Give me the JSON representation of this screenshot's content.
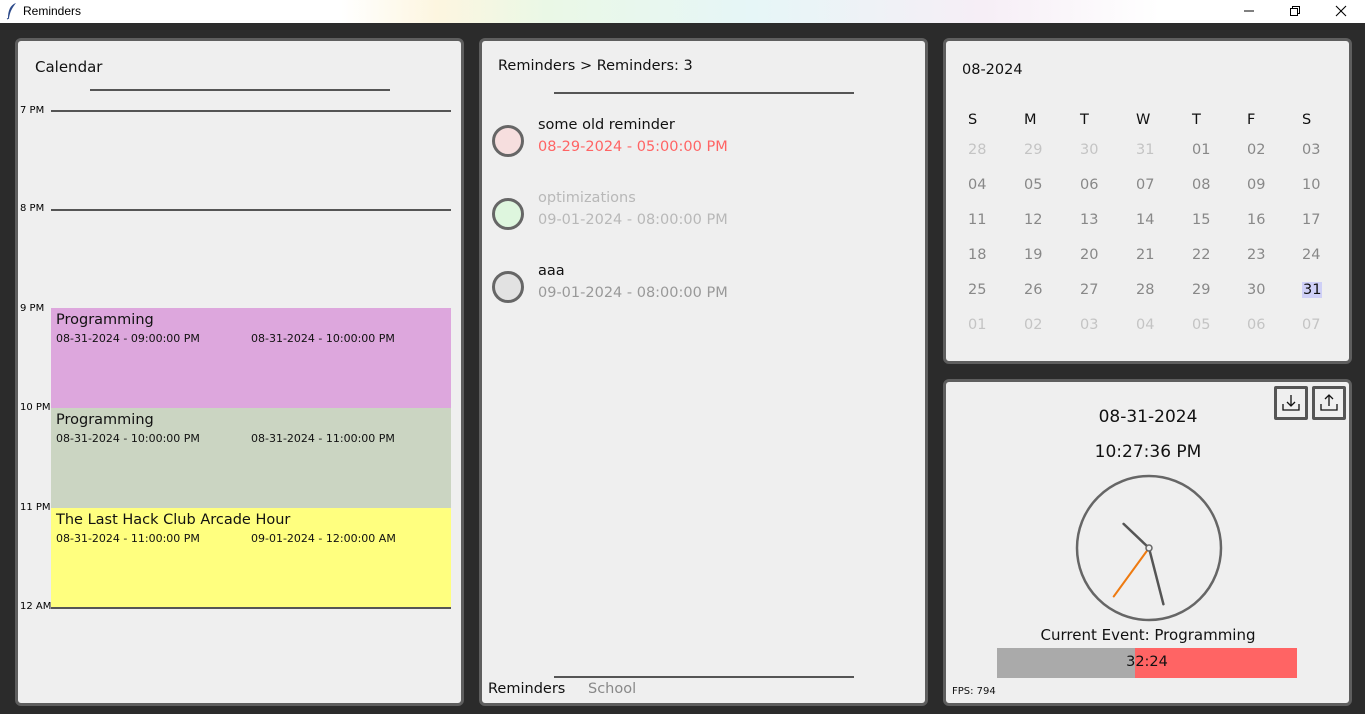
{
  "window": {
    "title": "Reminders"
  },
  "calendar": {
    "title": "Calendar",
    "hours": [
      "7 PM",
      "8 PM",
      "9 PM",
      "10 PM",
      "11 PM",
      "12 AM"
    ],
    "events": [
      {
        "title": "Programming",
        "start": "08-31-2024 - 09:00:00 PM",
        "end": "08-31-2024 - 10:00:00 PM",
        "color": "#dda7dd"
      },
      {
        "title": "Programming",
        "start": "08-31-2024 - 10:00:00 PM",
        "end": "08-31-2024 - 11:00:00 PM",
        "color": "#cbd5c2"
      },
      {
        "title": "The Last Hack Club Arcade Hour",
        "start": "08-31-2024 - 11:00:00 PM",
        "end": "09-01-2024 - 12:00:00 AM",
        "color": "#ffff7f"
      }
    ]
  },
  "reminders": {
    "breadcrumb": "Reminders > Reminders: 3",
    "items": [
      {
        "name": "some old reminder",
        "date": "08-29-2024 - 05:00:00 PM",
        "circle_color": "#f6dede",
        "name_color": "#111111",
        "date_color": "#ff6464"
      },
      {
        "name": "optimizations",
        "date": "09-01-2024 - 08:00:00 PM",
        "circle_color": "#def6de",
        "name_color": "#b8b8b8",
        "date_color": "#b8b8b8"
      },
      {
        "name": "aaa",
        "date": "09-01-2024 - 08:00:00 PM",
        "circle_color": "#e2e2e2",
        "name_color": "#111111",
        "date_color": "#999999"
      }
    ],
    "tabs": [
      "Reminders",
      "School"
    ]
  },
  "month_calendar": {
    "title": "08-2024",
    "weekdays": [
      "S",
      "M",
      "T",
      "W",
      "T",
      "F",
      "S"
    ],
    "weeks": [
      [
        "28",
        "29",
        "30",
        "31",
        "01",
        "02",
        "03"
      ],
      [
        "04",
        "05",
        "06",
        "07",
        "08",
        "09",
        "10"
      ],
      [
        "11",
        "12",
        "13",
        "14",
        "15",
        "16",
        "17"
      ],
      [
        "18",
        "19",
        "20",
        "21",
        "22",
        "23",
        "24"
      ],
      [
        "25",
        "26",
        "27",
        "28",
        "29",
        "30",
        "31"
      ],
      [
        "01",
        "02",
        "03",
        "04",
        "05",
        "06",
        "07"
      ]
    ],
    "today": "31"
  },
  "clock": {
    "date": "08-31-2024",
    "time": "10:27:36 PM",
    "current_event_label": "Current Event: Programming",
    "remaining": "32:24",
    "progress": 0.46,
    "fps": "FPS: 794",
    "icons": [
      "import-icon",
      "export-icon"
    ]
  }
}
